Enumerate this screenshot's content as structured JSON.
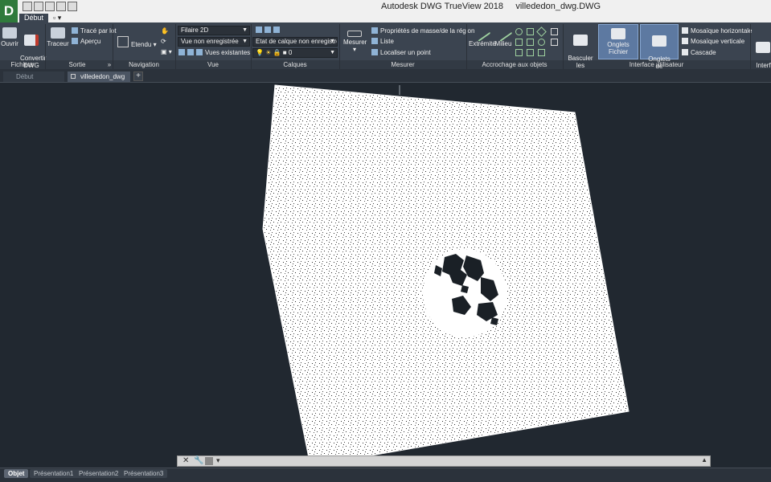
{
  "window": {
    "app_title": "Autodesk DWG TrueView 2018",
    "file_title": "villededon_dwg.DWG",
    "app_logo": "D"
  },
  "ribbon_tabs": [
    {
      "label": "Début",
      "active": true
    }
  ],
  "ribbon": {
    "fichiers": {
      "open": "Ouvrir",
      "convert": "Convertir\nDWG",
      "label": "Fichiers"
    },
    "sortie": {
      "plot": "Traceur",
      "batch_plot": "Tracé par lot",
      "preview": "Aperçu",
      "label": "Sortie",
      "expander": "»"
    },
    "navigation": {
      "extents": "Etendu",
      "label": "Navigation"
    },
    "vue": {
      "visual_style": "Filaire 2D",
      "named_view": "Vue non enregistrée",
      "existing_views": "Vues existantes",
      "label": "Vue"
    },
    "calques": {
      "layer_state": "Etat de calque non enregistré",
      "layer": "0",
      "label": "Calques"
    },
    "mesurer": {
      "measure": "Mesurer",
      "mass_props": "Propriétés de masse/de la région",
      "list": "Liste",
      "locate": "Localiser un point",
      "label": "Mesurer"
    },
    "accrochage": {
      "endpoint": "Extrémité",
      "midpoint": "Milieu",
      "label": "Accrochage aux objets"
    },
    "interface": {
      "switch_windows": "Basculer\nles fenêtres",
      "file_tabs": "Onglets Fichier",
      "layout_tabs": "Onglets\nde présentation",
      "tile_h": "Mosaïque horizontale",
      "tile_v": "Mosaïque verticale",
      "cascade": "Cascade",
      "user_iface": "Interf\nutilisat",
      "label": "Interface utilisateur"
    }
  },
  "doc_tabs": [
    {
      "label": "Début"
    },
    {
      "label": "villededon_dwg"
    }
  ],
  "add_tab": "+",
  "layout_tabs": [
    {
      "label": "Objet"
    },
    {
      "label": "Présentation1"
    },
    {
      "label": "Présentation2"
    },
    {
      "label": "Présentation3"
    }
  ],
  "colors": {
    "canvas_bg": "#212830",
    "ribbon_bg": "#3b4450",
    "accent": "#5d79a1"
  },
  "icons": [
    "open-icon",
    "convert-icon",
    "plot-icon",
    "pan-icon",
    "measure-icon",
    "snap-endpoint-icon",
    "close-icon",
    "wrench-icon"
  ]
}
